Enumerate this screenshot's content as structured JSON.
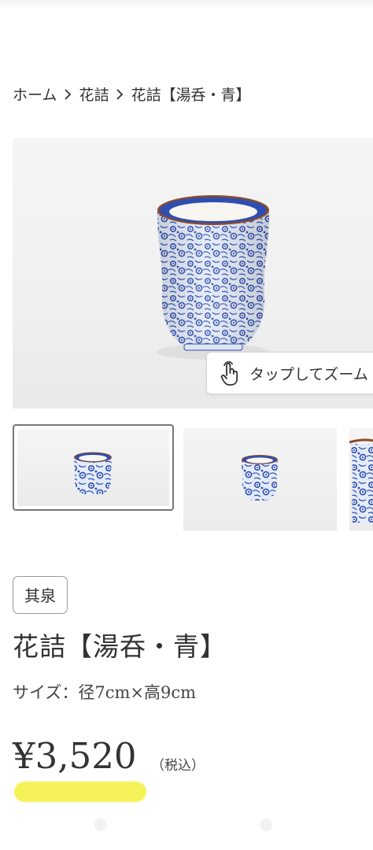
{
  "breadcrumb": {
    "items": [
      "ホーム",
      "花詰",
      "花詰【湯呑・青】"
    ]
  },
  "gallery": {
    "zoom_hint": "タップしてズーム",
    "icons": {
      "zoom": "tap-hand-icon",
      "separator": "chevron-right-icon"
    }
  },
  "product": {
    "brand": "其泉",
    "title": "花詰【湯呑・青】",
    "size": "サイズ：径7cm×高9cm",
    "price": "¥3,520",
    "tax_note": "（税込）"
  },
  "colors": {
    "text": "#333333",
    "highlight": "#f4ef3c",
    "cobalt": "#2f4fb0",
    "rim": "#8a4a2c"
  }
}
